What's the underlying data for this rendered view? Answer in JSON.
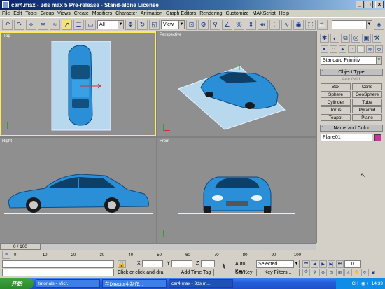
{
  "window": {
    "title": "car4.max - 3ds max 5 Pre-release - Stand-alone License"
  },
  "menu": [
    "File",
    "Edit",
    "Tools",
    "Group",
    "Views",
    "Create",
    "Modifiers",
    "Character",
    "Animation",
    "Graph Editors",
    "Rendering",
    "Customize",
    "MAXScript",
    "Help"
  ],
  "toolbar": {
    "selection_filter": "All",
    "reference_coord": "View"
  },
  "viewports": {
    "top": "Top",
    "perspective": "Perspective",
    "right": "Right",
    "front": "Front"
  },
  "command_panel": {
    "category": "Standard Primitiv",
    "object_type_title": "Object Type",
    "autogrid": "AutoGrid",
    "object_buttons": [
      "Box",
      "Cone",
      "Sphere",
      "GeoSphere",
      "Cylinder",
      "Tube",
      "Torus",
      "Pyramid",
      "Teapot",
      "Plane"
    ],
    "name_color_title": "Name and Color",
    "object_name": "Plane01",
    "object_color": "#cc3399"
  },
  "timeline": {
    "frame_display": "0 / 100",
    "ticks": [
      "0",
      "10",
      "20",
      "30",
      "40",
      "50",
      "60",
      "70",
      "80",
      "90",
      "100"
    ]
  },
  "status": {
    "prompt": "Click or click-and-dra",
    "add_time_tag": "Add Time Tag",
    "x_label": "X",
    "y_label": "Y",
    "z_label": "Z",
    "auto_key": "Auto Key",
    "set_key": "Set Key",
    "selected": "Selected",
    "key_filters": "Key Filters...",
    "frame": "0"
  },
  "taskbar": {
    "start": "开始",
    "tasks": [
      "tutorials - Micr.",
      "在Director中制作...",
      "car4.max - 3ds m..."
    ],
    "lang": "CH",
    "clock": "14:39"
  },
  "colors": {
    "active_viewport_border": "#ffe95c",
    "car_blue": "#2a8fd6",
    "viewport_bg": "#8f8f8f"
  }
}
